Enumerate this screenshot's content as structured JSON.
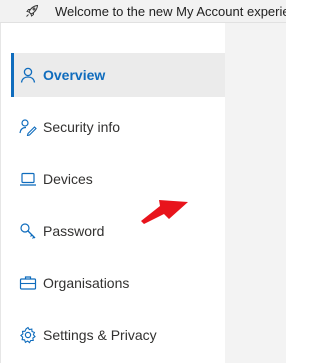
{
  "banner": {
    "text": "Welcome to the new My Account experience",
    "icon": "rocket-icon"
  },
  "sidebar": {
    "active_color": "#0f6cbd",
    "items": [
      {
        "label": "Overview",
        "icon": "person-icon",
        "active": true
      },
      {
        "label": "Security info",
        "icon": "security-info-icon",
        "active": false
      },
      {
        "label": "Devices",
        "icon": "laptop-icon",
        "active": false
      },
      {
        "label": "Password",
        "icon": "key-icon",
        "active": false
      },
      {
        "label": "Organisations",
        "icon": "briefcase-icon",
        "active": false
      },
      {
        "label": "Settings & Privacy",
        "icon": "gear-icon",
        "active": false
      }
    ]
  },
  "annotation": {
    "arrow_color": "#e8141c",
    "icon": "red-arrow-icon"
  }
}
